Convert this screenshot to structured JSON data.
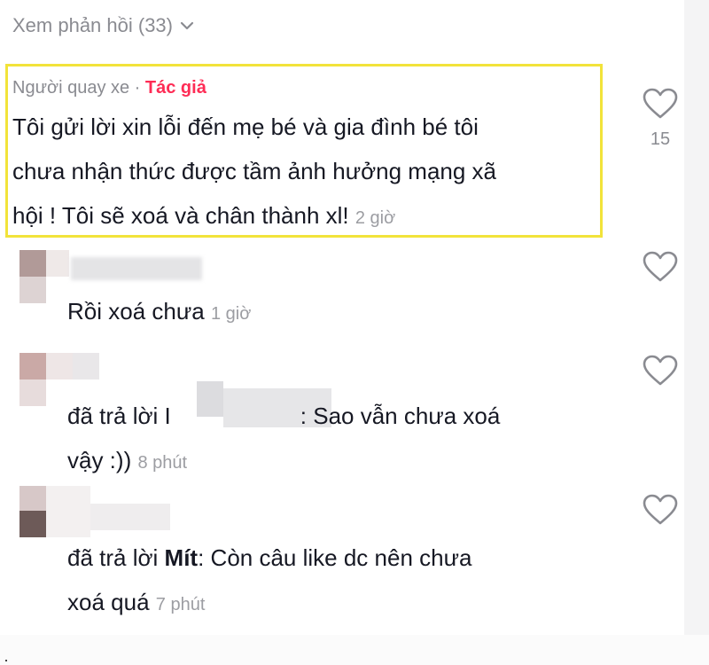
{
  "view_replies": {
    "label": "Xem phản hồi (33)"
  },
  "comments": [
    {
      "author": "Người quay xe",
      "separator": " · ",
      "author_tag": "Tác giả",
      "text_lines": [
        "Tôi gửi lời xin lỗi đến mẹ bé và gia đình bé tôi",
        "chưa nhận thức được tầm ảnh hưởng mạng xã",
        "hội ! Tôi sẽ xoá và chân thành xl!"
      ],
      "time": "2 giờ",
      "likes": "15"
    },
    {
      "text_lines": [
        "Rồi xoá chưa"
      ],
      "time": "1 giờ"
    },
    {
      "reply_prefix": "đã trả lời ",
      "reply_name_fragment": "I",
      "reply_text": ": Sao vẫn chưa xoá",
      "text_line2": "vậy :))",
      "time": "8 phút"
    },
    {
      "reply_prefix": "đã trả lời ",
      "reply_to": "Mít",
      "reply_text": ": Còn câu like dc nên chưa",
      "text_line2": "xoá quá",
      "time": "7 phút"
    }
  ],
  "colors": {
    "highlight_border": "#f2e33a",
    "author_tag": "#fe2c55",
    "secondary_text": "#8a8b91"
  },
  "icons": [
    "chevron-down-icon",
    "heart-icon"
  ]
}
